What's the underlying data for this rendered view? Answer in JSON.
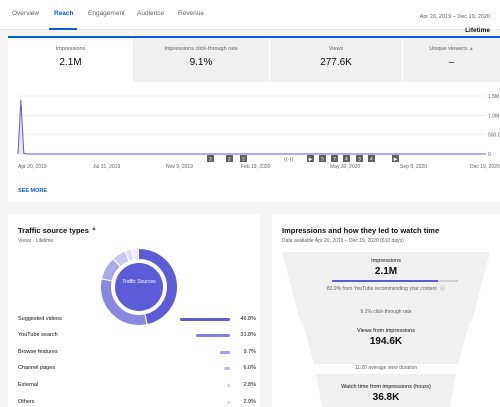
{
  "nav": {
    "tabs": [
      {
        "label": "Overview"
      },
      {
        "label": "Reach"
      },
      {
        "label": "Engagement"
      },
      {
        "label": "Audience"
      },
      {
        "label": "Revenue"
      }
    ],
    "active_tab": "Reach",
    "date_range": "Apr 20, 2019 – Dec 19, 2020",
    "period": "Lifetime"
  },
  "metrics": [
    {
      "label": "Impressions",
      "value": "2.1M"
    },
    {
      "label": "Impressions click-through rate",
      "value": "9.1%"
    },
    {
      "label": "Views",
      "value": "277.6K"
    },
    {
      "label": "Unique viewers",
      "value": "–"
    }
  ],
  "chart_data": {
    "type": "line",
    "x_tick_labels": [
      "Apr 20, 2019",
      "Jul 31, 2019",
      "Nov 9, 2019",
      "Feb 19, 2020",
      "May 30, 2020",
      "Sep 9, 2020",
      "Dec 19, 2020"
    ],
    "y_tick_labels": [
      "1.5M",
      "1.0M",
      "500.0K",
      "0"
    ],
    "ylim": [
      0,
      1500000
    ],
    "series": [
      {
        "values": [
          0,
          1400000,
          20000,
          0,
          0,
          0,
          0,
          0,
          0,
          0,
          0,
          0,
          0,
          0,
          0,
          0,
          0,
          0,
          0,
          0
        ]
      }
    ],
    "grid": true,
    "annotation_markers": [
      "2",
      "2",
      "2",
      "((·))",
      "▶",
      "5",
      "7",
      "4",
      "3",
      "4",
      "▶"
    ]
  },
  "see_more": "SEE MORE",
  "traffic": {
    "title": "Traffic source types",
    "subtitle": "Views · Lifetime",
    "donut_label": "Traffic Sources",
    "rows": [
      {
        "name": "Suggested videos",
        "value": "46.8%",
        "pct": 46.8
      },
      {
        "name": "YouTube search",
        "value": "31.8%",
        "pct": 31.8
      },
      {
        "name": "Browse features",
        "value": "9.7%",
        "pct": 9.7
      },
      {
        "name": "Channel pages",
        "value": "6.0%",
        "pct": 6.0
      },
      {
        "name": "External",
        "value": "2.8%",
        "pct": 2.8
      },
      {
        "name": "Others",
        "value": "2.9%",
        "pct": 2.9
      }
    ]
  },
  "funnel": {
    "title": "Impressions and how they led to watch time",
    "subtitle": "Data available Apr 20, 2019 – Dec 19, 2020 (610 days)",
    "impressions_label": "Impressions",
    "impressions_value": "2.1M",
    "recommend_note": "83.9% from YouTube recommending your content",
    "recommend_pct": 83.9,
    "ctr_note": "9.1% click-through rate",
    "views_label": "Views from impressions",
    "views_value": "194.6K",
    "avg_note": "11:20 average view duration",
    "watch_label": "Watch time from impressions (hours)",
    "watch_value": "36.8K"
  },
  "colors": {
    "accent": "#065fd4",
    "series": "#5c5cd6",
    "donut": [
      "#5c5cd6",
      "#8888e0",
      "#a9a9ea",
      "#c8c8f2",
      "#dcdcf6",
      "#ececfa"
    ]
  }
}
